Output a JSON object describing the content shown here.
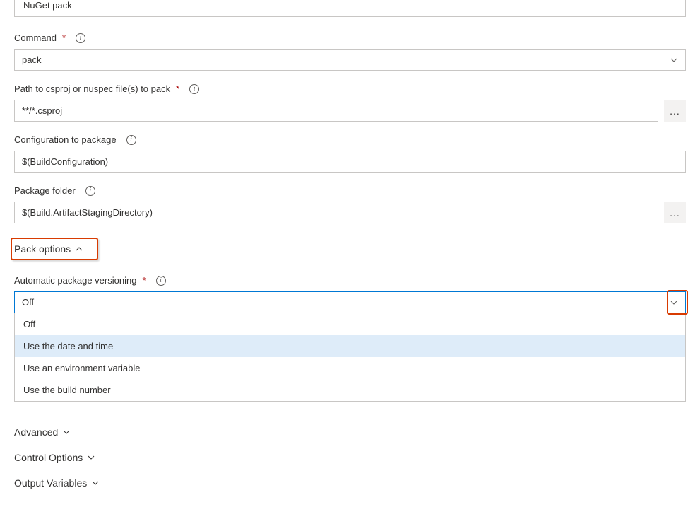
{
  "topField": {
    "value": "NuGet pack"
  },
  "command": {
    "label": "Command",
    "value": "pack"
  },
  "pathToCsproj": {
    "label": "Path to csproj or nuspec file(s) to pack",
    "value": "**/*.csproj"
  },
  "configToPackage": {
    "label": "Configuration to package",
    "value": "$(BuildConfiguration)"
  },
  "packageFolder": {
    "label": "Package folder",
    "value": "$(Build.ArtifactStagingDirectory)"
  },
  "sections": {
    "packOptions": "Pack options",
    "advanced": "Advanced",
    "controlOptions": "Control Options",
    "outputVariables": "Output Variables"
  },
  "autoVersioning": {
    "label": "Automatic package versioning",
    "value": "Off",
    "options": [
      "Off",
      "Use the date and time",
      "Use an environment variable",
      "Use the build number"
    ],
    "highlightedIndex": 1
  }
}
